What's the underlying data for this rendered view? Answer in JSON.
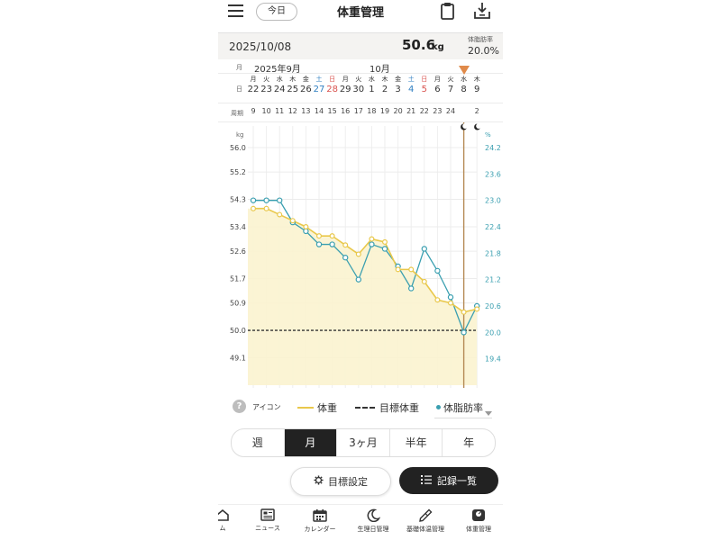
{
  "header": {
    "today_label": "今日",
    "title": "体重管理"
  },
  "summary": {
    "date": "2025/10/08",
    "weight_value": "50.6",
    "weight_unit": "kg",
    "fat_label": "体脂肪率",
    "fat_value": "20.0%"
  },
  "date_header": {
    "month_row_label": "月",
    "day_row_label": "日",
    "cycle_row_label": "周期",
    "month_sep": "2025年9月",
    "month_oct": "10月",
    "days": [
      {
        "wd": "月",
        "d": "22",
        "cycle": "9"
      },
      {
        "wd": "火",
        "d": "23",
        "cycle": "10"
      },
      {
        "wd": "水",
        "d": "24",
        "cycle": "11"
      },
      {
        "wd": "木",
        "d": "25",
        "cycle": "12"
      },
      {
        "wd": "金",
        "d": "26",
        "cycle": "13"
      },
      {
        "wd": "土",
        "d": "27",
        "cycle": "14",
        "kind": "sat"
      },
      {
        "wd": "日",
        "d": "28",
        "cycle": "15",
        "kind": "sun"
      },
      {
        "wd": "月",
        "d": "29",
        "cycle": "16"
      },
      {
        "wd": "火",
        "d": "30",
        "cycle": "17"
      },
      {
        "wd": "水",
        "d": "1",
        "cycle": "18"
      },
      {
        "wd": "木",
        "d": "2",
        "cycle": "19"
      },
      {
        "wd": "金",
        "d": "3",
        "cycle": "20"
      },
      {
        "wd": "土",
        "d": "4",
        "cycle": "21",
        "kind": "sat"
      },
      {
        "wd": "日",
        "d": "5",
        "cycle": "22",
        "kind": "sun"
      },
      {
        "wd": "月",
        "d": "6",
        "cycle": "23"
      },
      {
        "wd": "火",
        "d": "7",
        "cycle": "24"
      },
      {
        "wd": "水",
        "d": "8",
        "cycle": ""
      },
      {
        "wd": "木",
        "d": "9",
        "cycle": "2"
      }
    ]
  },
  "chart_data": {
    "type": "line",
    "y_left_unit": "kg",
    "y_right_unit": "%",
    "ylim_left": [
      48.2,
      56.0
    ],
    "ylim_right": [
      18.8,
      24.2
    ],
    "left_ticks": [
      "56.0",
      "55.2",
      "54.3",
      "53.4",
      "52.6",
      "51.7",
      "50.9",
      "50.0",
      "49.1"
    ],
    "left_tick_values": [
      56.0,
      55.2,
      54.3,
      53.4,
      52.6,
      51.7,
      50.9,
      50.0,
      49.1
    ],
    "right_ticks": [
      "24.2",
      "23.6",
      "23.0",
      "22.4",
      "21.8",
      "21.2",
      "20.6",
      "20.0",
      "19.4"
    ],
    "right_tick_values": [
      24.2,
      23.6,
      23.0,
      22.4,
      21.8,
      21.2,
      20.6,
      20.0,
      19.4
    ],
    "categories": [
      "9/22",
      "9/23",
      "9/24",
      "9/25",
      "9/26",
      "9/27",
      "9/28",
      "9/29",
      "9/30",
      "10/1",
      "10/2",
      "10/3",
      "10/4",
      "10/5",
      "10/6",
      "10/7",
      "10/8",
      "10/9"
    ],
    "series": [
      {
        "name": "体重",
        "axis": "left",
        "color": "#e9c84b",
        "fill": true,
        "values": [
          54.0,
          54.0,
          53.8,
          53.6,
          53.4,
          53.1,
          53.1,
          52.8,
          52.5,
          53.0,
          52.9,
          52.0,
          52.0,
          51.6,
          51.0,
          50.9,
          50.6,
          50.7
        ]
      },
      {
        "name": "体脂肪率",
        "axis": "right",
        "color": "#3a9fb0",
        "fill": false,
        "values": [
          23.0,
          23.0,
          23.0,
          22.5,
          22.3,
          22.0,
          22.0,
          21.7,
          21.2,
          22.0,
          21.9,
          21.5,
          21.0,
          21.9,
          21.4,
          20.8,
          20.0,
          20.6
        ]
      }
    ],
    "target_weight": 50.0,
    "target_color": "#333333",
    "selected_index": 16,
    "selected_line_color": "#b58a55",
    "marker_color": "#e08a4a",
    "grid": true
  },
  "legend": {
    "help_glyph": "?",
    "icon_label": "アイコン",
    "weight_label": "体重",
    "target_label": "目標体重",
    "fat_label": "体脂肪率"
  },
  "periods": {
    "items": [
      "週",
      "月",
      "3ヶ月",
      "半年",
      "年"
    ],
    "active": "月"
  },
  "actions": {
    "goal_label": "目標設定",
    "records_label": "記録一覧"
  },
  "bottom_nav": {
    "items": [
      {
        "label": "ム",
        "icon": "home-icon"
      },
      {
        "label": "ニュース",
        "icon": "news-icon"
      },
      {
        "label": "カレンダー",
        "icon": "calendar-icon"
      },
      {
        "label": "生理日管理",
        "icon": "moon-icon"
      },
      {
        "label": "基礎体温管理",
        "icon": "thermometer-icon"
      },
      {
        "label": "体重管理",
        "icon": "scale-icon"
      }
    ]
  }
}
